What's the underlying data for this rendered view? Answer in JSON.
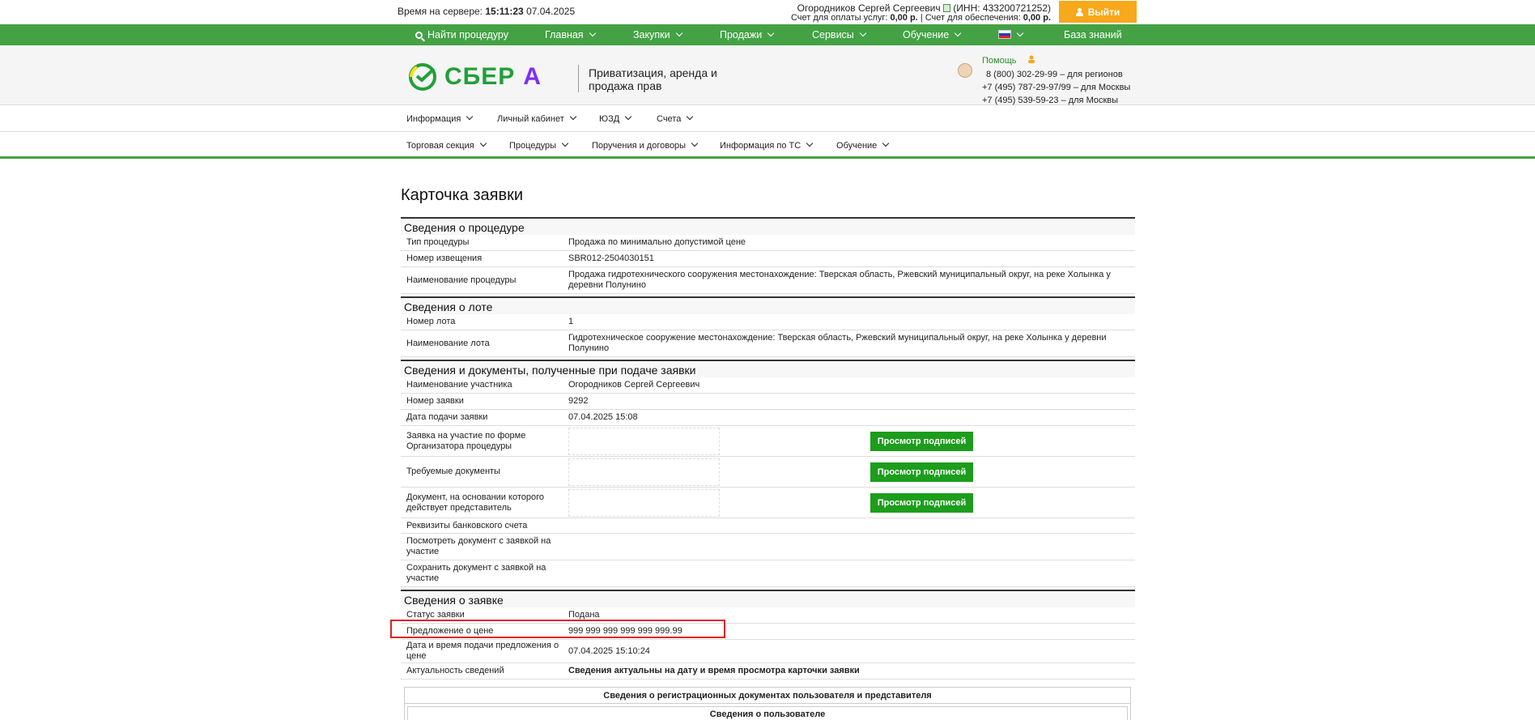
{
  "topbar": {
    "server_time_label": "Время на сервере:",
    "server_time": "15:11:23",
    "server_date": "07.04.2025",
    "user_name": "Огородников Сергей Сергеевич",
    "inn_text": "(ИНН: 433200721252)",
    "balance_services_label": "Счет для оплаты услуг:",
    "balance_services": "0,00 р.",
    "balance_security_label": "| Счет для обеспечения:",
    "balance_security": "0,00 р.",
    "logout_label": "Выйти"
  },
  "greennav": {
    "find_procedure": "Найти процедуру",
    "main": "Главная",
    "purchases": "Закупки",
    "sales": "Продажи",
    "services": "Сервисы",
    "training": "Обучение",
    "knowledge_base": "База знаний"
  },
  "header": {
    "logo_text": "СБЕР",
    "logo_suffix": "А",
    "tagline": "Приватизация, аренда и продажа прав",
    "help": "Помощь",
    "phones": [
      "8 (800) 302-29-99 – для регионов",
      "+7 (495) 787-29-97/99 – для Москвы",
      "+7 (495) 539-59-23 – для Москвы"
    ]
  },
  "menu1": [
    "Информация",
    "Личный кабинет",
    "ЮЗД",
    "Счета"
  ],
  "menu2": [
    "Торговая секция",
    "Процедуры",
    "Поручения и договоры",
    "Информация по ТС",
    "Обучение"
  ],
  "page_title": "Карточка заявки",
  "sections": {
    "procedure": {
      "title": "Сведения о процедуре",
      "rows": [
        {
          "label": "Тип процедуры",
          "value": "Продажа по минимально допустимой цене"
        },
        {
          "label": "Номер извещения",
          "value": "SBR012-2504030151"
        },
        {
          "label": "Наименование процедуры",
          "value": "Продажа гидротехнического сооружения местонахождение: Тверская область, Ржевский муниципальный округ, на реке Холынка у деревни Полунино"
        }
      ]
    },
    "lot": {
      "title": "Сведения о лоте",
      "rows": [
        {
          "label": "Номер лота",
          "value": "1"
        },
        {
          "label": "Наименование лота",
          "value": "Гидротехническое сооружение местонахождение: Тверская область, Ржевский муниципальный округ, на реке Холынка у деревни Полунино"
        }
      ]
    },
    "documents": {
      "title": "Сведения и документы, полученные при подаче заявки",
      "rows": [
        {
          "label": "Наименование участника",
          "value": "Огородников Сергей Сергеевич"
        },
        {
          "label": "Номер заявки",
          "value": "9292"
        },
        {
          "label": "Дата подачи заявки",
          "value": "07.04.2025 15:08"
        }
      ],
      "doc_rows": [
        {
          "label": "Заявка на участие по форме Организатора процедуры",
          "button": "Просмотр подписей"
        },
        {
          "label": "Требуемые документы",
          "button": "Просмотр подписей"
        },
        {
          "label": "Документ, на основании которого действует представитель",
          "button": "Просмотр подписей"
        }
      ],
      "extra_rows": [
        "Реквизиты банковского счета",
        "Посмотреть документ с заявкой на участие",
        "Сохранить документ с заявкой на участие"
      ]
    },
    "application": {
      "title": "Сведения о заявке",
      "rows": [
        {
          "label": "Статус заявки",
          "value": "Подана"
        },
        {
          "label": "Предложение о цене",
          "value": "999 999 999 999 999 999.99"
        },
        {
          "label": "Дата и время подачи предложения о цене",
          "value": "07.04.2025 15:10:24"
        },
        {
          "label": "Актуальность сведений",
          "value": "Сведения актуальны на дату и время просмотра карточки заявки"
        }
      ]
    }
  },
  "inner_table": {
    "title": "Сведения о регистрационных документах пользователя и представителя",
    "subtitle": "Сведения о пользователе"
  },
  "colors": {
    "brand_green": "#44a244",
    "button_green": "#1c9d1c",
    "logout_orange": "#f7a81b",
    "highlight_red": "#e02020"
  }
}
